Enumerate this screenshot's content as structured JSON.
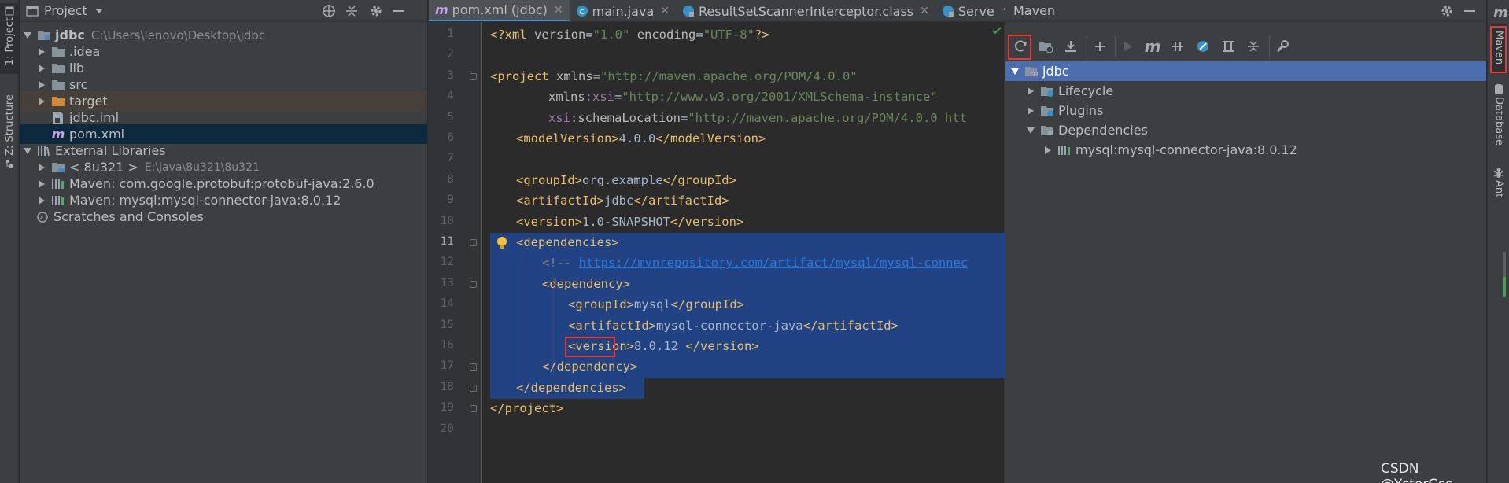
{
  "left_stripe": {
    "project_tab": "1: Project",
    "structure_tab": "Z: Structure"
  },
  "project_panel": {
    "title": "Project",
    "tree": [
      {
        "label": "jdbc",
        "path": "C:\\Users\\lenovo\\Desktop\\jdbc"
      },
      {
        "label": ".idea"
      },
      {
        "label": "lib"
      },
      {
        "label": "src"
      },
      {
        "label": "target"
      },
      {
        "label": "jdbc.iml"
      },
      {
        "label": "pom.xml"
      },
      {
        "label": "External Libraries"
      },
      {
        "label": "< 8u321 >",
        "path": "E:\\java\\8u321\\8u321"
      },
      {
        "label": "Maven: com.google.protobuf:protobuf-java:2.6.0"
      },
      {
        "label": "Maven: mysql:mysql-connector-java:8.0.12"
      },
      {
        "label": "Scratches and Consoles"
      }
    ]
  },
  "editor": {
    "tabs": [
      {
        "label": "pom.xml (jdbc)",
        "icon": "maven-icon"
      },
      {
        "label": "main.java",
        "icon": "java-class-icon"
      },
      {
        "label": "ResultSetScannerInterceptor.class",
        "icon": "class-file-icon"
      },
      {
        "label": "Servers",
        "icon": "class-file-icon"
      }
    ],
    "line_numbers": [
      "1",
      "2",
      "3",
      "4",
      "5",
      "6",
      "7",
      "8",
      "9",
      "10",
      "11",
      "12",
      "13",
      "14",
      "15",
      "16",
      "17",
      "18",
      "19",
      "20"
    ],
    "code": {
      "l1": [
        "<?xml ",
        "version",
        "=",
        "\"1.0\"",
        " ",
        "encoding",
        "=",
        "\"UTF-8\"",
        "?>"
      ],
      "l3": [
        "<project ",
        "xmlns",
        "=",
        "\"http://maven.apache.org/POM/4.0.0\""
      ],
      "l4": [
        "xmlns",
        ":xsi",
        "=",
        "\"http://www.w3.org/2001/XMLSchema-instance\""
      ],
      "l5": [
        "xsi",
        ":schemaLocation",
        "=",
        "\"http://maven.apache.org/POM/4.0.0 htt"
      ],
      "l6": [
        "<modelVersion>",
        "4.0.0",
        "</modelVersion>"
      ],
      "l8": [
        "<groupId>",
        "org.example",
        "</groupId>"
      ],
      "l9": [
        "<artifactId>",
        "jdbc",
        "</artifactId>"
      ],
      "l10": [
        "<version>",
        "1.0-SNAPSHOT",
        "</version>"
      ],
      "l11": "<dependencies>",
      "l12": [
        "<!-- ",
        "https://mvnrepository.com/artifact/mysql/mysql-connec"
      ],
      "l13": "<dependency>",
      "l14": [
        "<groupId>",
        "mysql",
        "</groupId>"
      ],
      "l15": [
        "<artifactId>",
        "mysql-connector-java",
        "</artifactId>"
      ],
      "l16": [
        "<version>",
        "8.0.12",
        " ",
        "</version>"
      ],
      "l17": "</dependency>",
      "l18": "</dependencies>",
      "l19": "</project>"
    }
  },
  "maven_panel": {
    "title": "Maven",
    "tree": [
      {
        "label": "jdbc"
      },
      {
        "label": "Lifecycle"
      },
      {
        "label": "Plugins"
      },
      {
        "label": "Dependencies"
      },
      {
        "label": "mysql:mysql-connector-java:8.0.12"
      }
    ]
  },
  "right_stripe": {
    "maven_tab": "Maven",
    "database_tab": "Database",
    "ant_tab": "Ant"
  },
  "watermark": "CSDN @YsterCcc",
  "colors": {
    "selection": "#214283",
    "highlight_box": "#e53935",
    "tree_selected": "#0d293e",
    "maven_selected": "#4b6eaf"
  }
}
